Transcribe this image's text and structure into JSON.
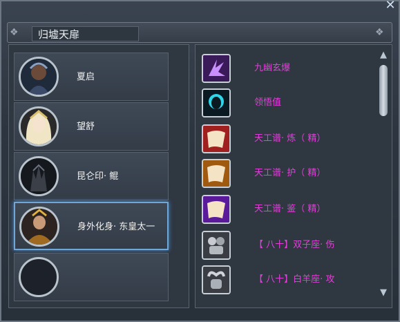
{
  "window": {
    "close_icon": "close-icon",
    "close_glyph": "✕"
  },
  "header": {
    "title": "归墟天扉"
  },
  "characters": [
    {
      "name": "夏启",
      "portrait": "warrior-portrait"
    },
    {
      "name": "望舒",
      "portrait": "maiden-portrait"
    },
    {
      "name": "昆仑印· 鲲",
      "portrait": "creature-portrait"
    },
    {
      "name": "身外化身· 东皇太一",
      "portrait": "emperor-portrait",
      "selected": true
    },
    {
      "name": "",
      "portrait": "empty-slot"
    }
  ],
  "items": [
    {
      "name": "九幽玄爆",
      "icon": "purple-crystal-icon"
    },
    {
      "name": "领悟值",
      "icon": "silhouette-head-icon"
    },
    {
      "name": "天工谱· 炼（ 精）",
      "icon": "scroll-red-icon"
    },
    {
      "name": "天工谱· 护（ 精）",
      "icon": "scroll-orange-icon"
    },
    {
      "name": "天工谱· 鉴（ 精）",
      "icon": "scroll-purple-icon"
    },
    {
      "name": "【 八十】双子座· 伤",
      "icon": "gemini-icon"
    },
    {
      "name": "【 八十】白羊座· 攻",
      "icon": "aries-icon"
    }
  ],
  "scrollbar": {
    "up_glyph": "▲",
    "down_glyph": "▼"
  },
  "colors": {
    "item_text": "#e040d8",
    "selected_border": "#6fa7d8"
  }
}
